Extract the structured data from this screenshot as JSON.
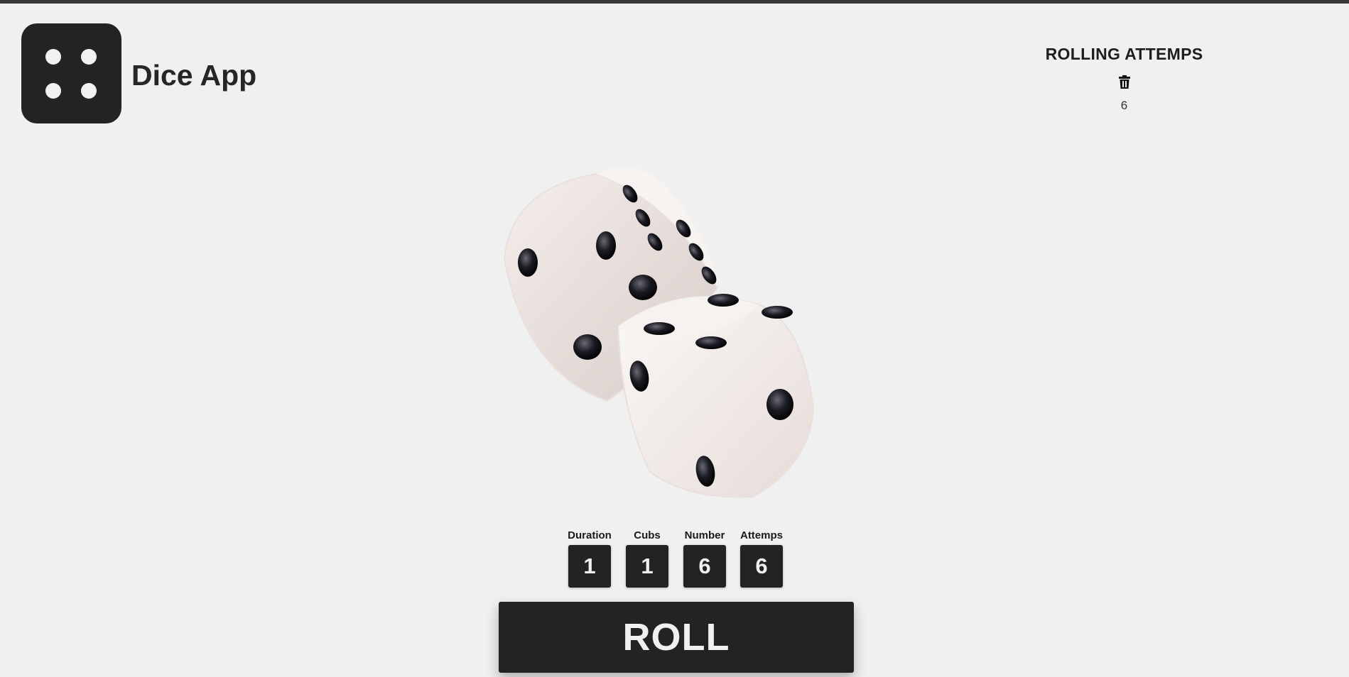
{
  "app": {
    "title": "Dice App",
    "logo_icon": "dice-four-icon"
  },
  "attempts_panel": {
    "title": "ROLLING ATTEMPS",
    "clear_icon": "trash-icon",
    "items": [
      "6"
    ]
  },
  "stats": [
    {
      "label": "Duration",
      "value": "1"
    },
    {
      "label": "Cubs",
      "value": "1"
    },
    {
      "label": "Number",
      "value": "6"
    },
    {
      "label": "Attemps",
      "value": "6"
    }
  ],
  "roll_button": {
    "label": "ROLL"
  },
  "colors": {
    "background": "#f0f0f0",
    "dark": "#232323",
    "light_text": "#f0f0f0"
  }
}
